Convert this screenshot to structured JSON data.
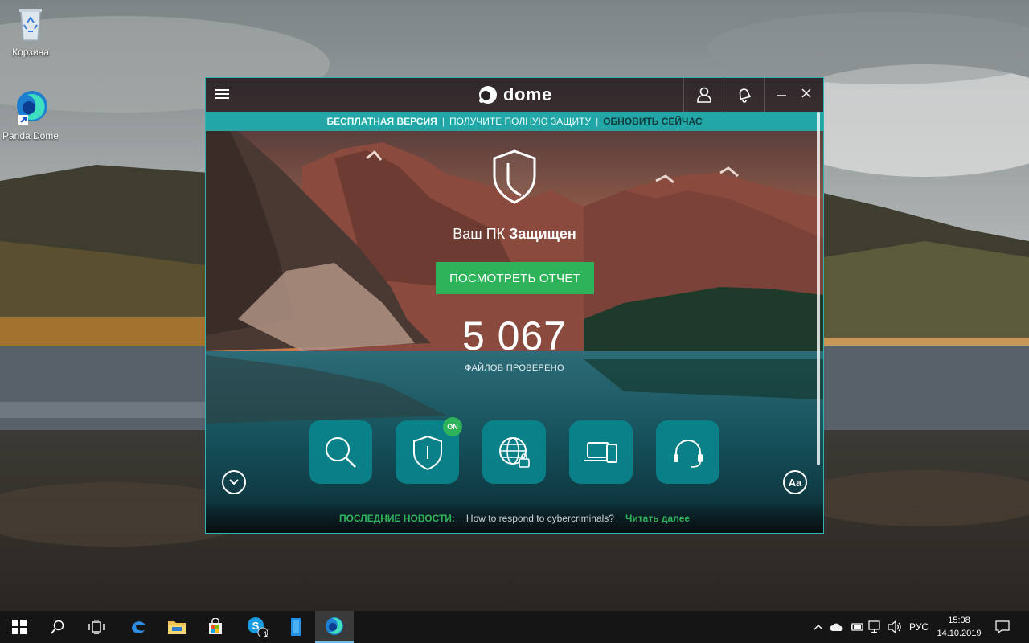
{
  "desktop": {
    "icons": [
      {
        "label": "Корзина",
        "icon": "recycle-bin-icon"
      },
      {
        "label": "Panda Dome",
        "icon": "panda-dome-icon"
      }
    ]
  },
  "app": {
    "logo_text": "dome",
    "promo": {
      "free_version": "БЕСПЛАТНАЯ ВЕРСИЯ",
      "separator": "|",
      "get_protection": "ПОЛУЧИТЕ ПОЛНУЮ ЗАЩИТУ",
      "upgrade": "ОБНОВИТЬ СЕЙЧАС"
    },
    "status": {
      "prefix": "Ваш ПК",
      "state": "Защищен"
    },
    "report_button": "ПОСМОТРЕТЬ ОТЧЕТ",
    "files_scanned": {
      "count": "5 067",
      "label": "ФАЙЛОВ ПРОВЕРЕНО"
    },
    "tiles": [
      {
        "name": "scan",
        "icon": "search-icon"
      },
      {
        "name": "antivirus",
        "icon": "shield-icon",
        "badge": "ON"
      },
      {
        "name": "web-protection",
        "icon": "globe-lock-icon"
      },
      {
        "name": "devices",
        "icon": "devices-icon"
      },
      {
        "name": "support",
        "icon": "headset-icon"
      }
    ],
    "font_button": "Aa",
    "news": {
      "header": "ПОСЛЕДНИЕ НОВОСТИ:",
      "headline": "How to respond to cybercriminals?",
      "read_more": "Читать далее"
    },
    "accent_color": "#22a7a6",
    "button_color": "#2fb35a"
  },
  "taskbar": {
    "language": "РУС",
    "time": "15:08",
    "date": "14.10.2019",
    "skype_badge": "1",
    "items": [
      "start-icon",
      "search-icon",
      "task-view-icon",
      "edge-icon",
      "file-explorer-icon",
      "store-icon",
      "skype-icon",
      "app-icon",
      "panda-dome-icon"
    ]
  }
}
